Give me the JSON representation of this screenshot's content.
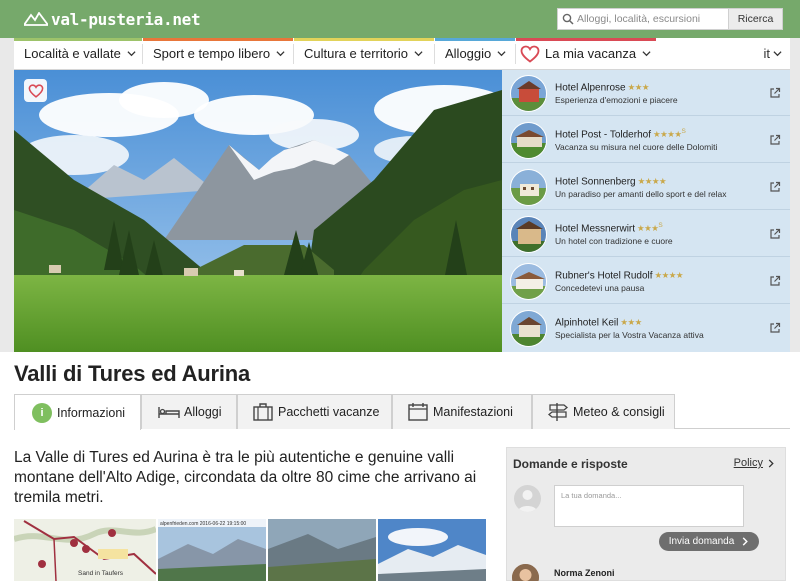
{
  "header": {
    "logo_text": "val-pusteria.net",
    "logo_icon": "mountain-icon",
    "search_placeholder": "Alloggi, località, escursioni",
    "search_button": "Ricerca"
  },
  "nav": {
    "items": [
      {
        "label": "Località e vallate",
        "color": "#9dc36a"
      },
      {
        "label": "Sport e tempo libero",
        "color": "#e8763a"
      },
      {
        "label": "Cultura e territorio",
        "color": "#e2d35a"
      },
      {
        "label": "Alloggio",
        "color": "#57a8d8"
      },
      {
        "label": "La mia vacanza",
        "color": "#d94a55"
      }
    ],
    "language": "it"
  },
  "hotels": [
    {
      "name": "Hotel Alpenrose",
      "stars": "★★★",
      "sup": "",
      "tagline": "Esperienza d'emozioni e piacere"
    },
    {
      "name": "Hotel Post - Tolderhof",
      "stars": "★★★★",
      "sup": "S",
      "tagline": "Vacanza su misura nel cuore delle Dolomiti"
    },
    {
      "name": "Hotel Sonnenberg",
      "stars": "★★★★",
      "sup": "",
      "tagline": "Un paradiso per amanti dello sport e del relax"
    },
    {
      "name": "Hotel Messnerwirt",
      "stars": "★★★",
      "sup": "S",
      "tagline": "Un hotel con tradizione e cuore"
    },
    {
      "name": "Rubner's Hotel Rudolf",
      "stars": "★★★★",
      "sup": "",
      "tagline": "Concedetevi una pausa"
    },
    {
      "name": "Alpinhotel Keil",
      "stars": "★★★",
      "sup": "",
      "tagline": "Specialista per la Vostra Vacanza attiva"
    }
  ],
  "page": {
    "title": "Valli di Tures ed Aurina",
    "tabs": [
      {
        "label": "Informazioni",
        "icon": "info-icon"
      },
      {
        "label": "Alloggi",
        "icon": "bed-icon"
      },
      {
        "label": "Pacchetti vacanze",
        "icon": "suitcase-icon"
      },
      {
        "label": "Manifestazioni",
        "icon": "calendar-icon"
      },
      {
        "label": "Meteo & consigli",
        "icon": "signpost-icon"
      }
    ],
    "info_icon_glyph": "i",
    "intro": "La Valle di Tures ed Aurina è tra le più autentiche e genuine valli montane dell'Alto Adige, circondata da oltre 80 cime che arrivano ai tremila metri."
  },
  "thumbs": {
    "map_label": "Sand in Taufers",
    "webcam_caption": "alpenfrieden.com 2016-06-22 19:15:00"
  },
  "qa": {
    "title": "Domande e risposte",
    "policy": "Policy",
    "placeholder": "La tua domanda...",
    "send_button": "Invia domanda",
    "user_name": "Norma Zenoni"
  }
}
